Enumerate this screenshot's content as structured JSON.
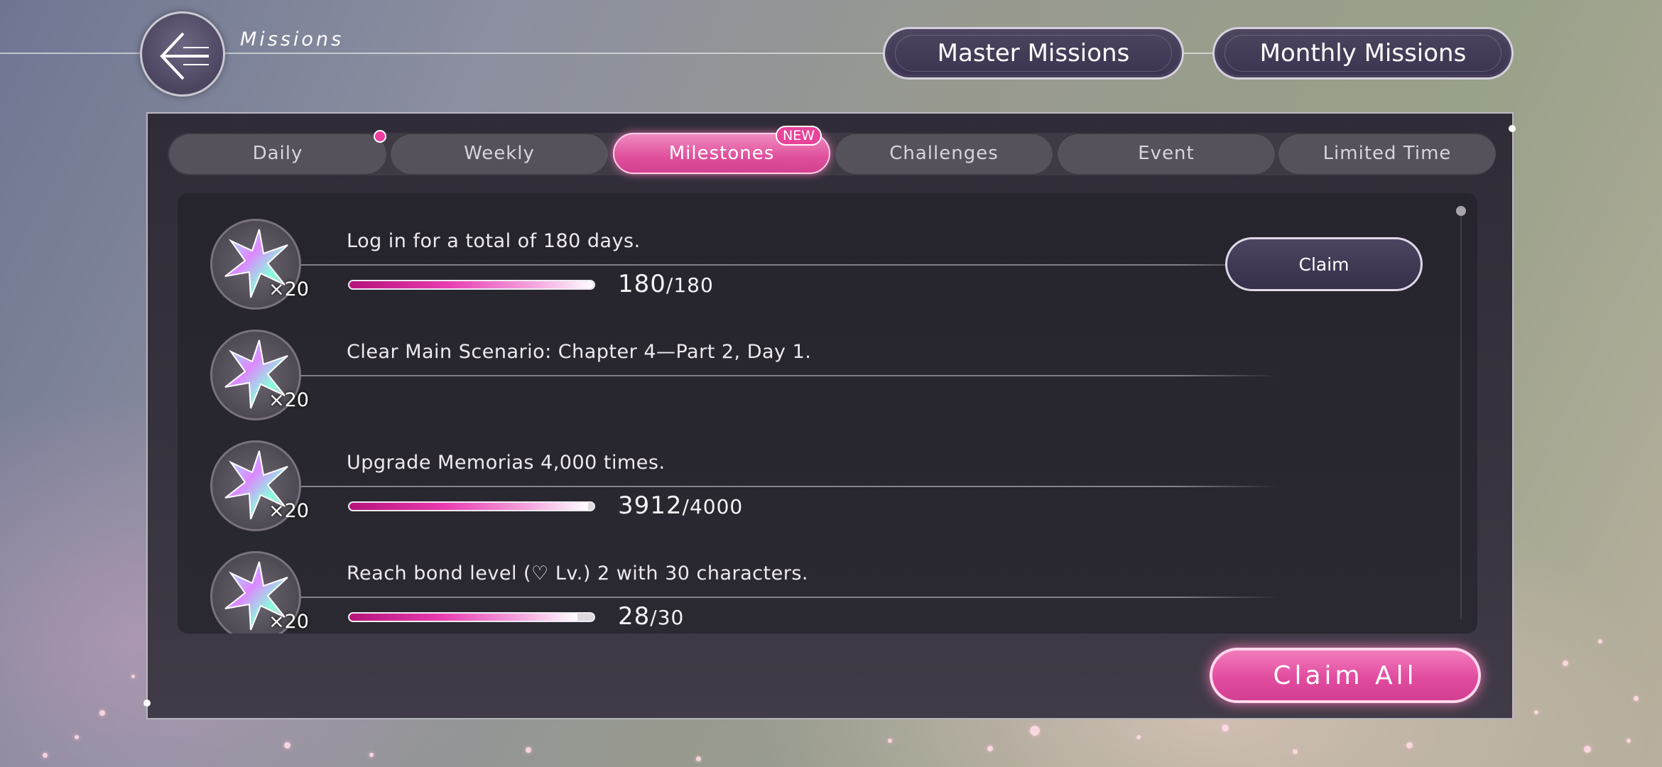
{
  "header": {
    "title": "Missions",
    "buttons": [
      "Master Missions",
      "Monthly Missions"
    ]
  },
  "tabs": [
    {
      "label": "Daily",
      "active": false,
      "dot": true
    },
    {
      "label": "Weekly",
      "active": false
    },
    {
      "label": "Milestones",
      "active": true,
      "badge": "NEW"
    },
    {
      "label": "Challenges",
      "active": false
    },
    {
      "label": "Event",
      "active": false
    },
    {
      "label": "Limited Time",
      "active": false
    }
  ],
  "missions": [
    {
      "description": "Log in for a total of 180 days.",
      "reward_qty": "×20",
      "current": "180",
      "total": "/180",
      "progress": 1.0,
      "claim_label": "Claim"
    },
    {
      "description": "Clear Main Scenario: Chapter 4—Part 2, Day 1.",
      "reward_qty": "×20"
    },
    {
      "description": "Upgrade Memorias 4,000 times.",
      "reward_qty": "×20",
      "current": "3912",
      "total": "/4000",
      "progress": 0.978
    },
    {
      "description": "Reach bond level (♡ Lv.) 2 with 30 characters.",
      "reward_qty": "×20",
      "current": "28",
      "total": "/30",
      "progress": 0.933
    }
  ],
  "footer": {
    "claim_all_label": "Claim All"
  },
  "colors": {
    "accent": "#e14c9f",
    "panel": "#2f2c37",
    "button": "#4c4460"
  }
}
